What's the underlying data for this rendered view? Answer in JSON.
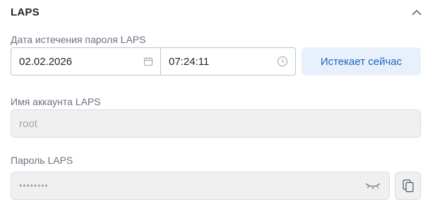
{
  "section": {
    "title": "LAPS"
  },
  "expiration": {
    "label": "Дата истечения пароля LAPS",
    "date_value": "02.02.2026",
    "time_value": "07:24:11",
    "expire_now_label": "Истекает сейчас"
  },
  "account": {
    "label": "Имя аккаунта LAPS",
    "value": "root"
  },
  "password": {
    "label": "Пароль LAPS",
    "masked_value": "••••••••"
  },
  "icons": {
    "collapse": "chevron-up-icon",
    "calendar": "calendar-icon",
    "clock": "clock-icon",
    "visibility": "eye-closed-icon",
    "copy": "copy-icon"
  },
  "colors": {
    "accent": "#1d63c4",
    "accent_bg": "#e8f1fb",
    "disabled_bg": "#f0f0f1"
  }
}
